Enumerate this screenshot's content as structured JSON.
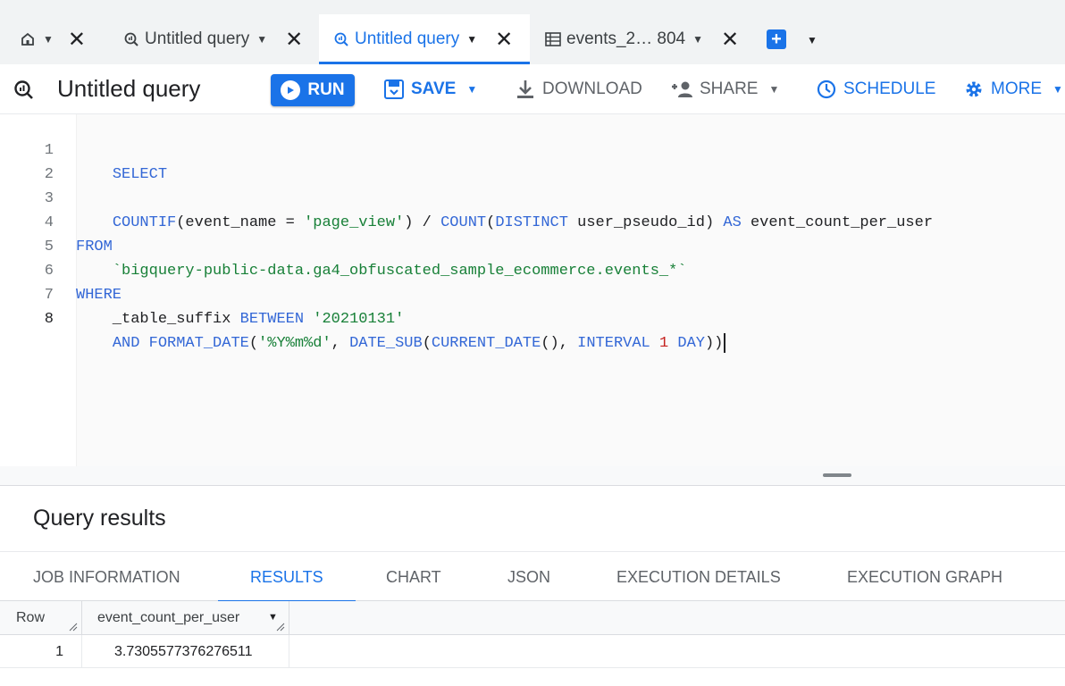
{
  "tabs": [
    {
      "icon": "home-icon",
      "label": ""
    },
    {
      "icon": "query-icon",
      "label": "Untitled query"
    },
    {
      "icon": "query-icon",
      "label": "Untitled query",
      "active": true
    },
    {
      "icon": "table-icon",
      "label": "events_2… 804"
    }
  ],
  "toolbar": {
    "title": "Untitled query",
    "run": "RUN",
    "save": "SAVE",
    "download": "DOWNLOAD",
    "share": "SHARE",
    "schedule": "SCHEDULE",
    "more": "MORE"
  },
  "editor": {
    "line_numbers": [
      "1",
      "2",
      "3",
      "4",
      "5",
      "6",
      "7",
      "8"
    ],
    "lines": [
      "    SELECT",
      "",
      "    COUNTIF(event_name = 'page_view') / COUNT(DISTINCT user_pseudo_id) AS event_count_per_user",
      "FROM",
      "    `bigquery-public-data.ga4_obfuscated_sample_ecommerce.events_*`",
      "WHERE",
      "    _table_suffix BETWEEN '20210131'",
      "    AND FORMAT_DATE('%Y%m%d', DATE_SUB(CURRENT_DATE(), INTERVAL 1 DAY))"
    ],
    "current_line": 8
  },
  "results": {
    "title": "Query results",
    "tabs": [
      "JOB INFORMATION",
      "RESULTS",
      "CHART",
      "JSON",
      "EXECUTION DETAILS",
      "EXECUTION GRAPH"
    ],
    "active_tab": "RESULTS",
    "columns": [
      "Row",
      "event_count_per_user"
    ],
    "rows": [
      [
        "1",
        "3.7305577376276511"
      ]
    ]
  },
  "colors": {
    "accent": "#1a73e8",
    "keyword": "#3367d6",
    "string": "#188038",
    "number": "#c5221f"
  }
}
